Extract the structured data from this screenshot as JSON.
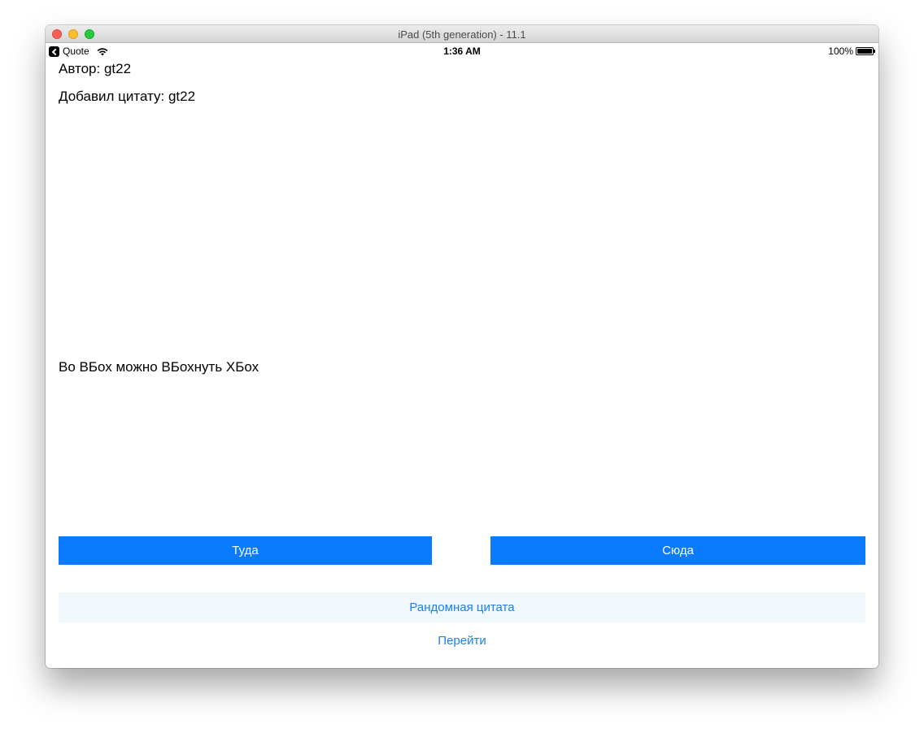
{
  "window": {
    "title": "iPad (5th generation) - 11.1"
  },
  "status_bar": {
    "back_app": "Quote",
    "time": "1:36 AM",
    "battery": "100%",
    "battery_level": 1.0
  },
  "content": {
    "author": "Автор: gt22",
    "added_by": "Добавил цитату: gt22",
    "quote": "Во ВБох можно ВБохнуть ХБох"
  },
  "buttons": {
    "back": "Туда",
    "forward": "Сюда",
    "random": "Рандомная цитата",
    "go": "Перейти"
  },
  "colors": {
    "accent": "#0a7bff",
    "link": "#1a7ff6",
    "random_bg": "#f0f8fc"
  },
  "icons": {
    "back_app": "back-chevron-icon",
    "wifi": "wifi-icon",
    "battery": "battery-icon"
  }
}
